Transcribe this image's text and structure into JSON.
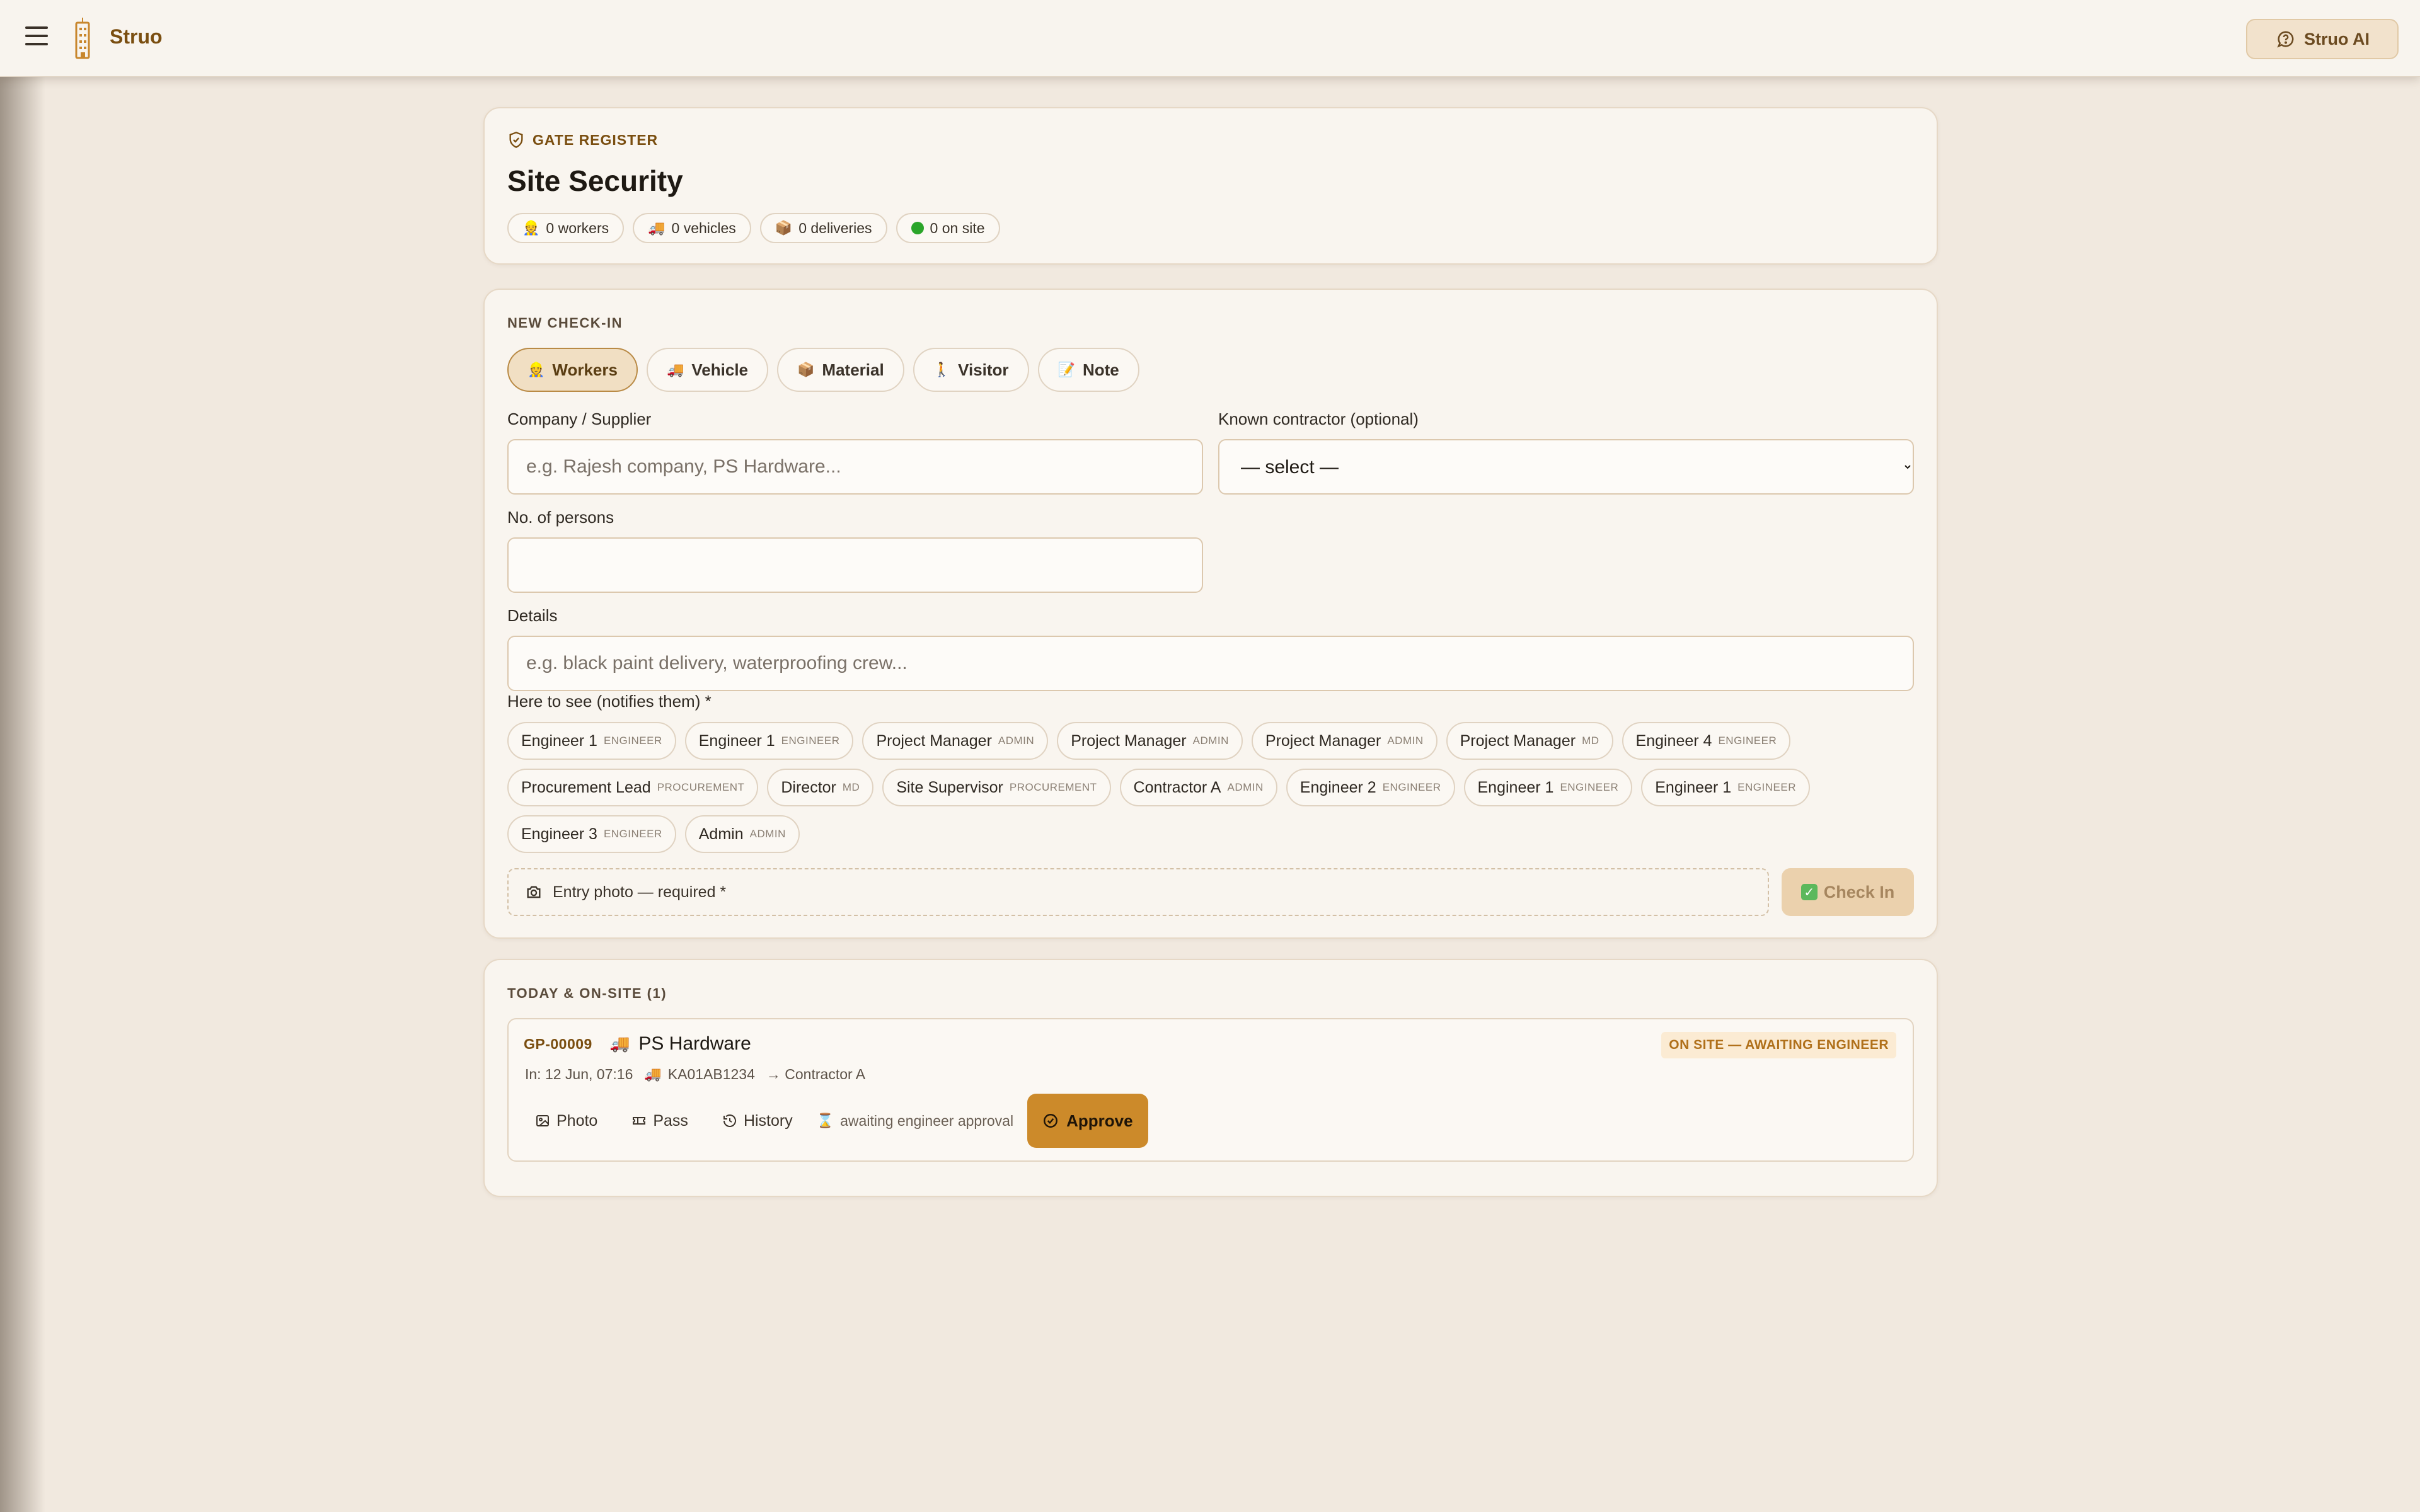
{
  "app": {
    "brand": "Struo",
    "ai_button": "Struo AI"
  },
  "header": {
    "eyebrow": "GATE REGISTER",
    "title": "Site Security",
    "stats": [
      {
        "icon": "👷",
        "label": "0 workers"
      },
      {
        "icon": "🚚",
        "label": "0 vehicles"
      },
      {
        "icon": "📦",
        "label": "0 deliveries"
      },
      {
        "icon": "green-dot",
        "label": "0 on site"
      }
    ]
  },
  "checkin": {
    "section_label": "NEW CHECK-IN",
    "types": [
      {
        "icon": "👷",
        "label": "Workers",
        "active": true
      },
      {
        "icon": "🚚",
        "label": "Vehicle",
        "active": false
      },
      {
        "icon": "📦",
        "label": "Material",
        "active": false
      },
      {
        "icon": "🚶",
        "label": "Visitor",
        "active": false
      },
      {
        "icon": "📝",
        "label": "Note",
        "active": false
      }
    ],
    "company_label": "Company / Supplier",
    "company_placeholder": "e.g. Rajesh company, PS Hardware...",
    "contractor_label": "Known contractor (optional)",
    "contractor_selected": "— select —",
    "persons_label": "No. of persons",
    "persons_value": "",
    "details_label": "Details",
    "details_placeholder": "e.g. black paint delivery, waterproofing crew...",
    "here_to_see_label": "Here to see (notifies them) *",
    "people": [
      {
        "name": "Engineer 1",
        "role": "ENGINEER"
      },
      {
        "name": "Engineer 1",
        "role": "ENGINEER"
      },
      {
        "name": "Project Manager",
        "role": "ADMIN"
      },
      {
        "name": "Project Manager",
        "role": "ADMIN"
      },
      {
        "name": "Project Manager",
        "role": "ADMIN"
      },
      {
        "name": "Project Manager",
        "role": "MD"
      },
      {
        "name": "Engineer 4",
        "role": "ENGINEER"
      },
      {
        "name": "Procurement Lead",
        "role": "PROCUREMENT"
      },
      {
        "name": "Director",
        "role": "MD"
      },
      {
        "name": "Site Supervisor",
        "role": "PROCUREMENT"
      },
      {
        "name": "Contractor A",
        "role": "ADMIN"
      },
      {
        "name": "Engineer 2",
        "role": "ENGINEER"
      },
      {
        "name": "Engineer 1",
        "role": "ENGINEER"
      },
      {
        "name": "Engineer 1",
        "role": "ENGINEER"
      },
      {
        "name": "Engineer 3",
        "role": "ENGINEER"
      },
      {
        "name": "Admin",
        "role": "ADMIN"
      }
    ],
    "photo_label": "Entry photo — required *",
    "checkin_button": "Check In"
  },
  "today": {
    "section_label": "TODAY & ON-SITE (1)",
    "entries": [
      {
        "id": "GP-00009",
        "icon": "🚚",
        "company": "PS Hardware",
        "status": "ON SITE — AWAITING ENGINEER",
        "time": "In: 12 Jun, 07:16",
        "vehicle": "KA01AB1234",
        "host": "→ Contractor A",
        "actions": {
          "photo": "Photo",
          "pass": "Pass",
          "history": "History"
        },
        "awaiting": "awaiting engineer approval",
        "approve": "Approve"
      }
    ]
  },
  "colors": {
    "accent": "#cc8a2a",
    "brand": "#7a4e10",
    "background": "#f1e9df",
    "card": "#f9f5ef"
  }
}
